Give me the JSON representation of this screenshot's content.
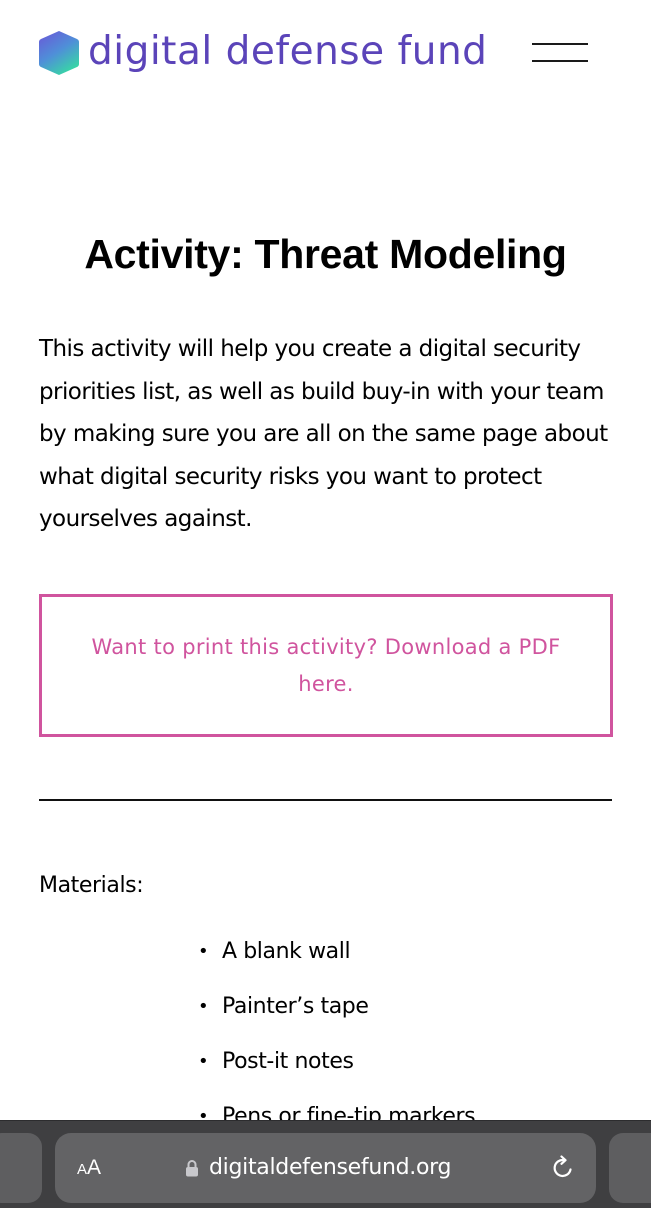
{
  "header": {
    "logo_text": "digital defense fund",
    "logo_icon": "hexagon-gradient-logo",
    "menu_icon": "hamburger-menu-icon"
  },
  "main": {
    "title": "Activity: Threat Modeling",
    "intro": "This activity will help you create a digital security priorities list, as well as build buy-in with your team by making sure you are all on the same page about what digital security risks you want to protect yourselves against.",
    "print_link": "Want to print this activity? Download a PDF here.",
    "materials_label": "Materials:",
    "materials": [
      "A blank wall",
      "Painter’s tape",
      "Post-it notes",
      "Pens or fine-tip markers"
    ]
  },
  "browser": {
    "text_size_small": "A",
    "text_size_large": "A",
    "url": "digitaldefensefund.org",
    "lock_icon": "lock-icon",
    "reload_icon": "reload-icon"
  },
  "colors": {
    "brand_purple": "#5b44b9",
    "accent_pink": "#d0549e",
    "browser_bar": "#3f3f41",
    "address_pill": "#636365"
  }
}
